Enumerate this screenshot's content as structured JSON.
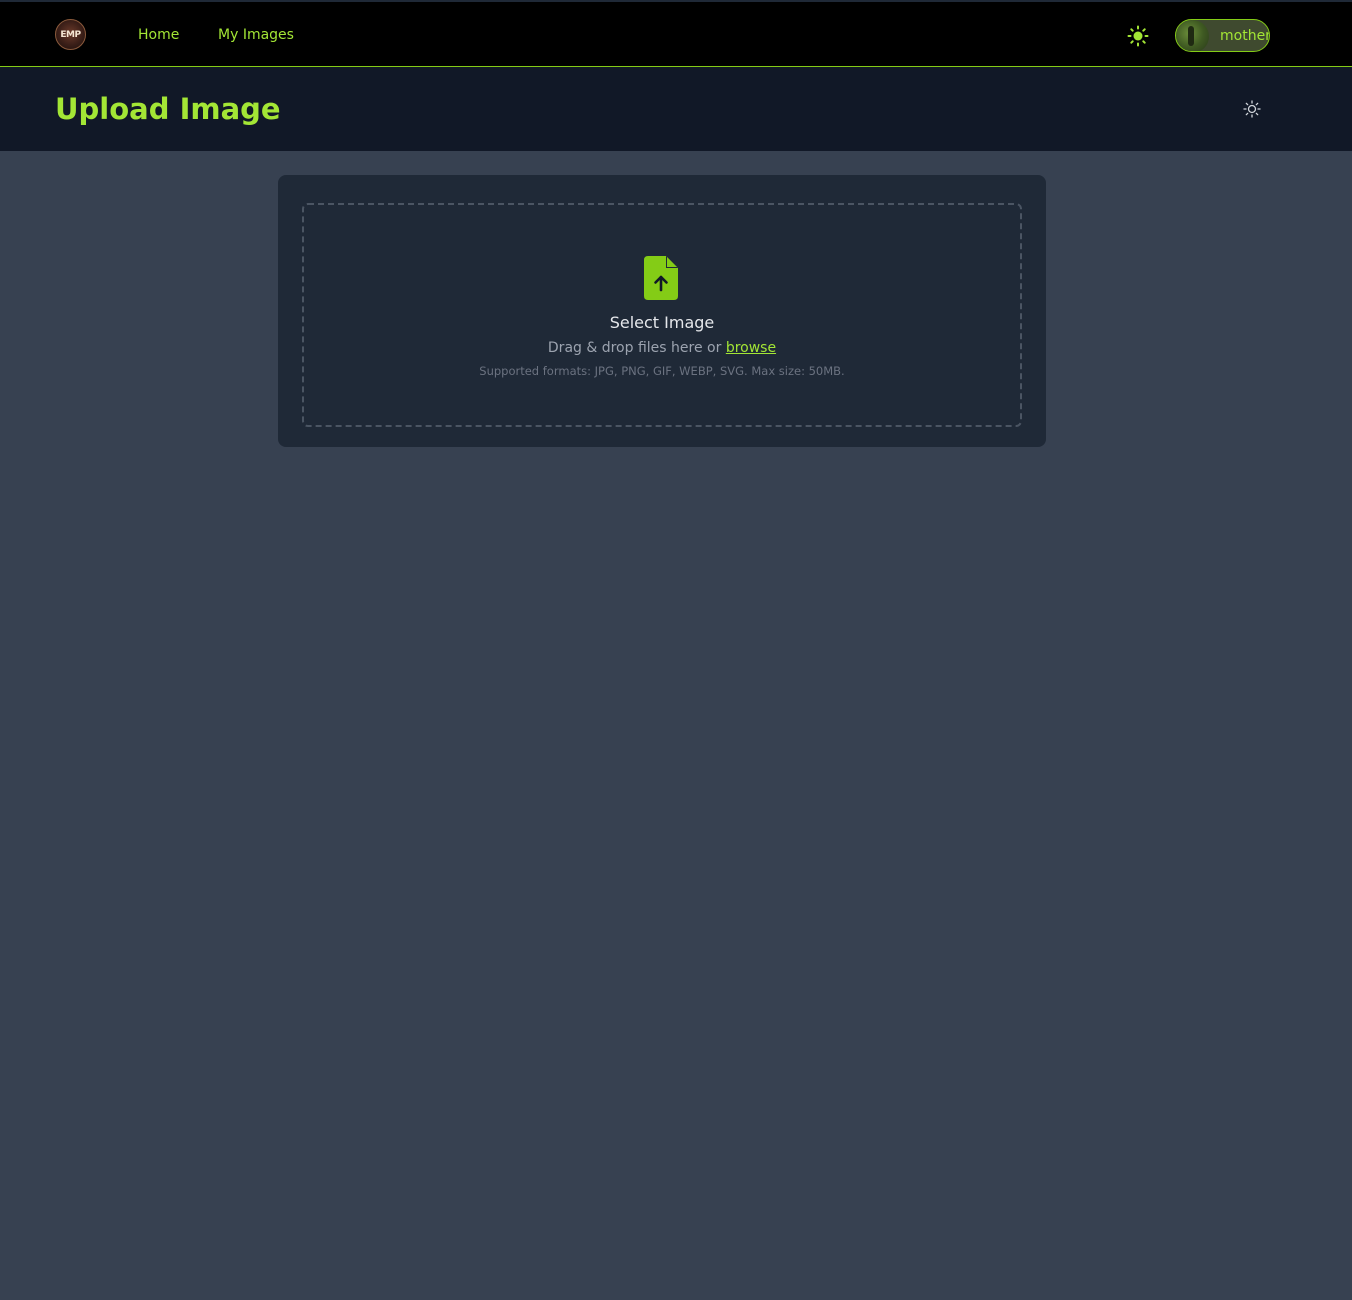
{
  "topbar": {
    "logo_text": "EMP",
    "nav": {
      "home": "Home",
      "my_images": "My Images"
    },
    "user": {
      "name": "mother"
    }
  },
  "header": {
    "title": "Upload Image"
  },
  "upload": {
    "title": "Select Image",
    "drag_text": "Drag & drop files here or",
    "browse_label": "browse",
    "formats": "Supported formats: JPG, PNG, GIF, WEBP, SVG. Max size: 50MB."
  },
  "icons": {
    "theme_toggle_top": "sun-icon",
    "theme_toggle_header": "sun-outline-icon",
    "upload": "file-upload-icon"
  },
  "colors": {
    "accent": "#a3e635",
    "accent_strong": "#84cc16",
    "page_bg": "#374151",
    "topbar_bg": "#000000",
    "header_bg": "#111827",
    "card_bg": "#1f2937"
  }
}
